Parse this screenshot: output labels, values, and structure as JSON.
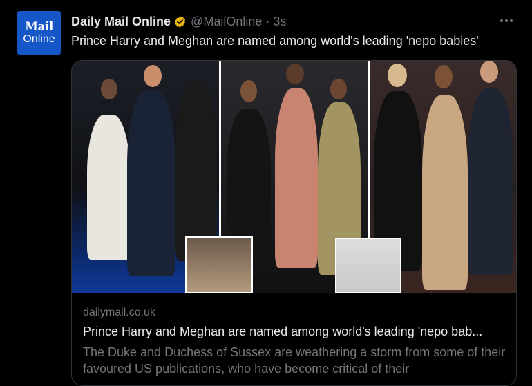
{
  "account": {
    "avatar_line1": "Mail",
    "avatar_line2": "Online",
    "display_name": "Daily Mail Online",
    "handle": "@MailOnline",
    "separator": "·",
    "timestamp": "3s",
    "verified_icon": "verified-badge-icon",
    "verified_color": "#e8b70d",
    "avatar_color": "#1657c7"
  },
  "tweet": {
    "text": "Prince Harry and Meghan are named among world's leading 'nepo babies'"
  },
  "card": {
    "domain": "dailymail.co.uk",
    "title": "Prince Harry and Meghan are named among world's leading 'nepo bab...",
    "description": "The Duke and Duchess of Sussex are weathering a storm from some of their favoured US publications, who have become critical of their"
  },
  "colors": {
    "background": "#000000",
    "primary_text": "#e7e9ea",
    "secondary_text": "#71767b",
    "border": "#2f3336"
  }
}
